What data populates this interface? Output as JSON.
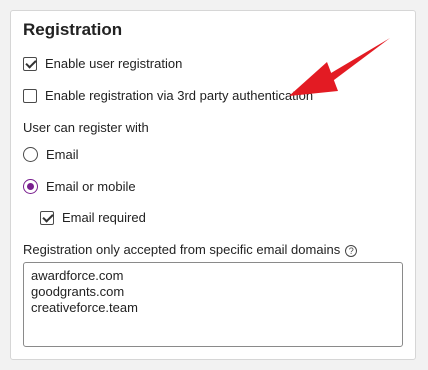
{
  "registration": {
    "title": "Registration",
    "enable_user_registration": {
      "label": "Enable user registration",
      "checked": true
    },
    "enable_third_party": {
      "label": "Enable registration via 3rd party authentication",
      "checked": false
    },
    "register_with_label": "User can register with",
    "options": [
      {
        "label": "Email",
        "selected": false
      },
      {
        "label": "Email or mobile",
        "selected": true
      }
    ],
    "email_required": {
      "label": "Email required",
      "checked": true
    },
    "domains_label": "Registration only accepted from specific email domains",
    "help_glyph": "?",
    "domains": [
      "awardforce.com",
      "goodgrants.com",
      "creativeforce.team"
    ]
  },
  "colors": {
    "accent": "#7a1f8f",
    "annotation_arrow": "#e31b23"
  },
  "icons": {
    "help": "question-circle-icon",
    "annotation": "red-arrow-icon"
  }
}
